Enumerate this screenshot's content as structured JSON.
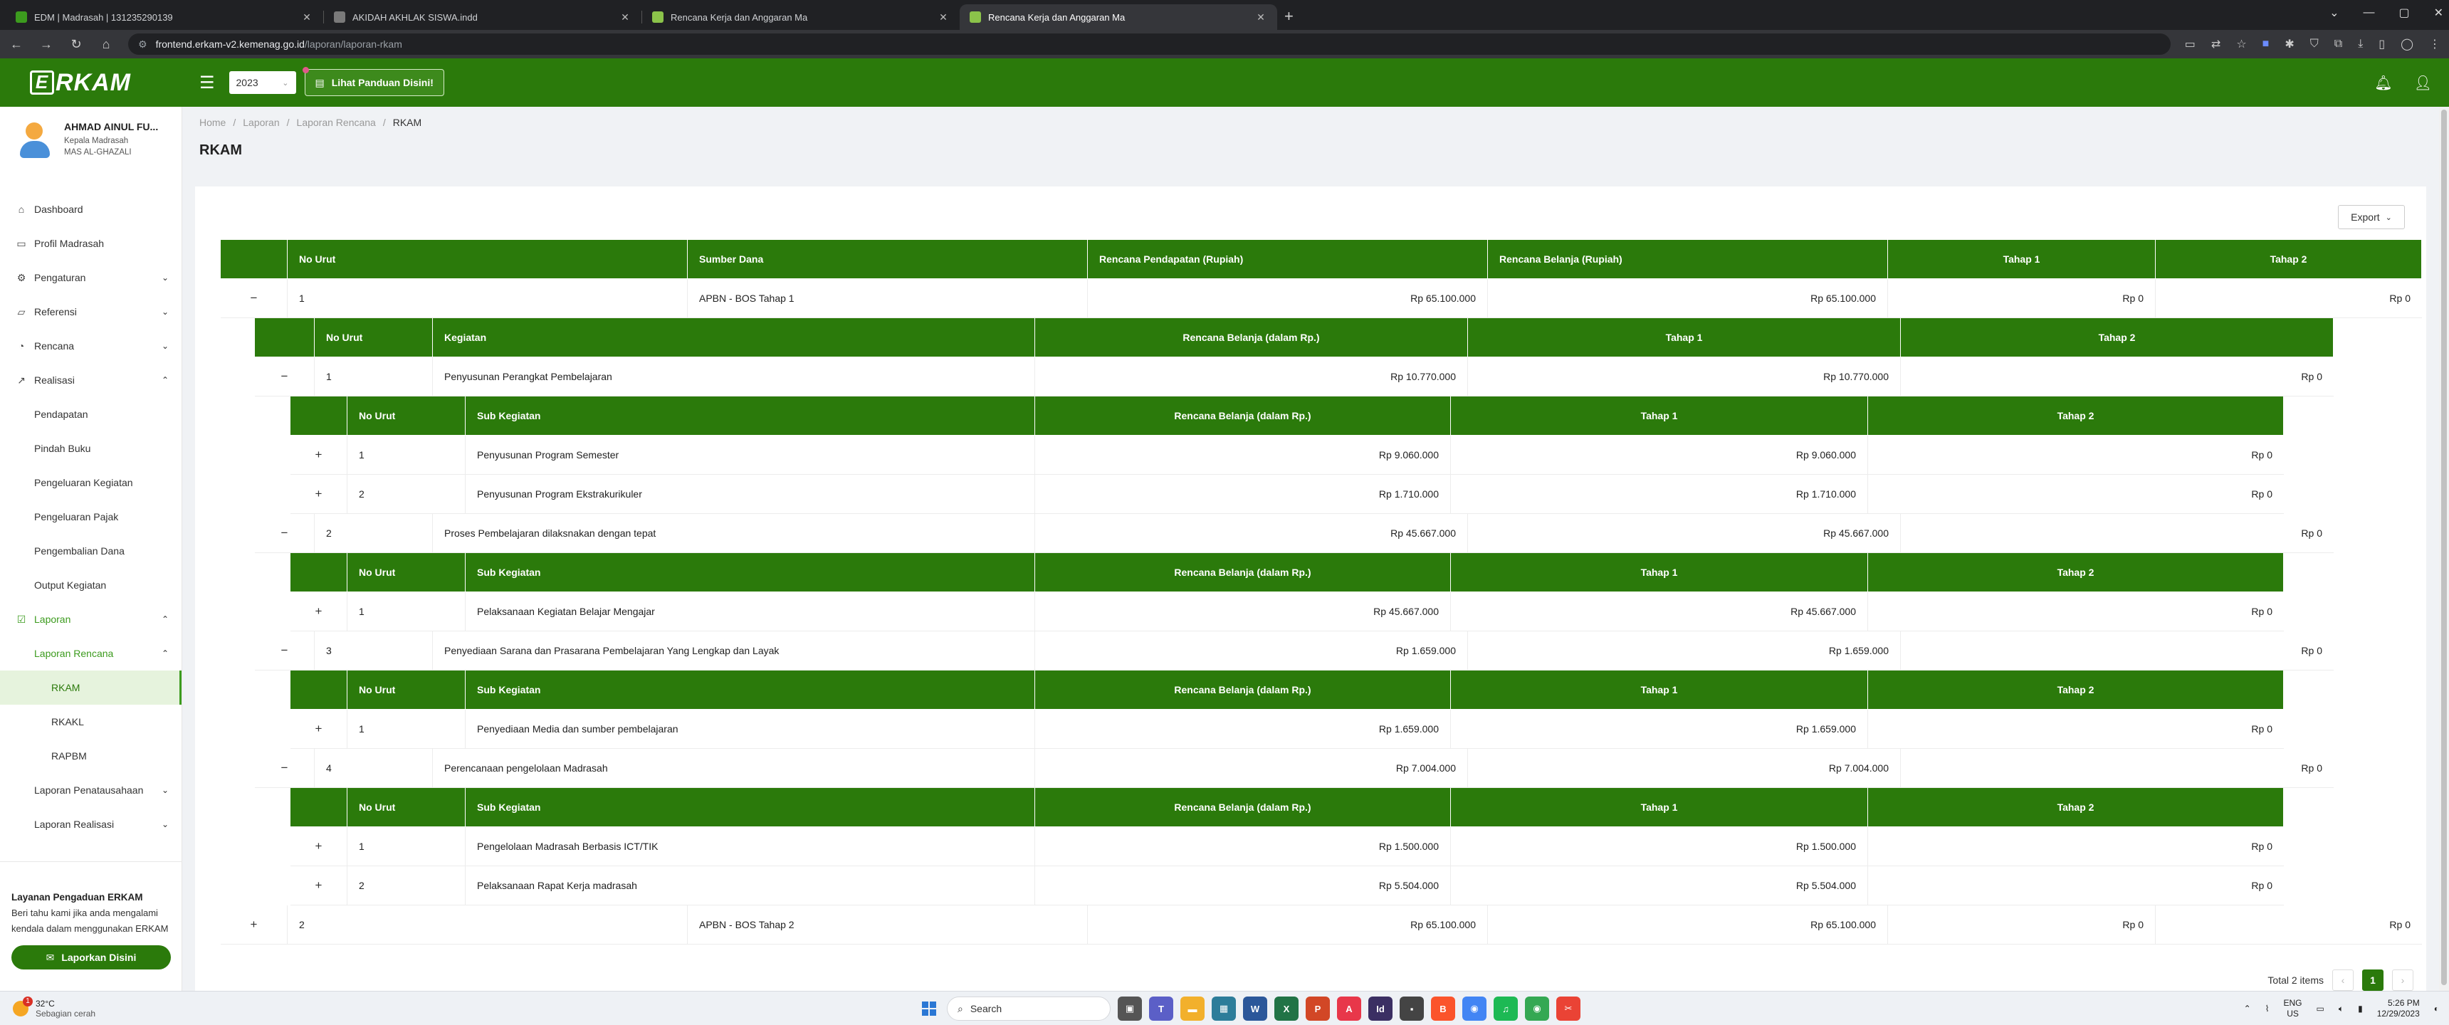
{
  "browser": {
    "tabs": [
      {
        "title": "EDM | Madrasah | 131235290139",
        "fav_color": "#3c9b1e",
        "active": false
      },
      {
        "title": "AKIDAH AKHLAK SISWA.indd",
        "fav_color": "#7a7a7a",
        "active": false
      },
      {
        "title": "Rencana Kerja dan Anggaran Ma",
        "fav_color": "#8bc34a",
        "active": false
      },
      {
        "title": "Rencana Kerja dan Anggaran Ma",
        "fav_color": "#8bc34a",
        "active": true
      }
    ],
    "url_host": "frontend.erkam-v2.kemenag.go.id",
    "url_path": "/laporan/laporan-rkam"
  },
  "header": {
    "logo": "ERKAM",
    "year": "2023",
    "guide_label": "Lihat Panduan Disini!"
  },
  "profile": {
    "name": "AHMAD AINUL FU...",
    "role": "Kepala Madrasah",
    "school": "MAS AL-GHAZALI"
  },
  "sidebar": {
    "dashboard": "Dashboard",
    "profil": "Profil Madrasah",
    "pengaturan": "Pengaturan",
    "referensi": "Referensi",
    "rencana": "Rencana",
    "realisasi": "Realisasi",
    "realisasi_items": [
      "Pendapatan",
      "Pindah Buku",
      "Pengeluaran Kegiatan",
      "Pengeluaran Pajak",
      "Pengembalian Dana",
      "Output Kegiatan"
    ],
    "laporan": "Laporan",
    "laporan_rencana": "Laporan Rencana",
    "laporan_rencana_items": [
      "RKAM",
      "RKAKL",
      "RAPBM"
    ],
    "laporan_penatausahaan": "Laporan Penatausahaan",
    "laporan_realisasi": "Laporan Realisasi"
  },
  "complaint": {
    "title": "Layanan Pengaduan ERKAM",
    "desc": "Beri tahu kami jika anda mengalami kendala dalam menggunakan ERKAM",
    "button": "Laporkan Disini"
  },
  "breadcrumb": [
    "Home",
    "Laporan",
    "Laporan Rencana",
    "RKAM"
  ],
  "page_title": "RKAM",
  "export_label": "Export",
  "table": {
    "headers": [
      "No Urut",
      "Sumber Dana",
      "Rencana Pendapatan (Rupiah)",
      "Rencana Belanja (Rupiah)",
      "Tahap 1",
      "Tahap 2"
    ],
    "sub_headers": [
      "No Urut",
      "Kegiatan",
      "Rencana Belanja (dalam Rp.)",
      "Tahap 1",
      "Tahap 2"
    ],
    "subsub_headers": [
      "No Urut",
      "Sub Kegiatan",
      "Rencana Belanja (dalam Rp.)",
      "Tahap 1",
      "Tahap 2"
    ],
    "rows": [
      {
        "expander": "−",
        "no": "1",
        "sumber": "APBN - BOS Tahap 1",
        "pendapatan": "Rp 65.100.000",
        "belanja": "Rp 65.100.000",
        "tahap1": "Rp 0",
        "tahap2": "Rp 0",
        "kegiatan": [
          {
            "expander": "−",
            "no": "1",
            "name": "Penyusunan Perangkat Pembelajaran",
            "belanja": "Rp 10.770.000",
            "tahap1": "Rp 10.770.000",
            "tahap2": "Rp 0",
            "sub": [
              {
                "expander": "+",
                "no": "1",
                "name": "Penyusunan Program Semester",
                "belanja": "Rp 9.060.000",
                "tahap1": "Rp 9.060.000",
                "tahap2": "Rp 0"
              },
              {
                "expander": "+",
                "no": "2",
                "name": "Penyusunan Program Ekstrakurikuler",
                "belanja": "Rp 1.710.000",
                "tahap1": "Rp 1.710.000",
                "tahap2": "Rp 0"
              }
            ]
          },
          {
            "expander": "−",
            "no": "2",
            "name": "Proses Pembelajaran dilaksnakan dengan tepat",
            "belanja": "Rp 45.667.000",
            "tahap1": "Rp 45.667.000",
            "tahap2": "Rp 0",
            "sub": [
              {
                "expander": "+",
                "no": "1",
                "name": "Pelaksanaan Kegiatan Belajar Mengajar",
                "belanja": "Rp 45.667.000",
                "tahap1": "Rp 45.667.000",
                "tahap2": "Rp 0"
              }
            ]
          },
          {
            "expander": "−",
            "no": "3",
            "name": "Penyediaan Sarana dan Prasarana Pembelajaran Yang Lengkap dan Layak",
            "belanja": "Rp 1.659.000",
            "tahap1": "Rp 1.659.000",
            "tahap2": "Rp 0",
            "sub": [
              {
                "expander": "+",
                "no": "1",
                "name": "Penyediaan Media dan sumber pembelajaran",
                "belanja": "Rp 1.659.000",
                "tahap1": "Rp 1.659.000",
                "tahap2": "Rp 0"
              }
            ]
          },
          {
            "expander": "−",
            "no": "4",
            "name": "Perencanaan pengelolaan Madrasah",
            "belanja": "Rp 7.004.000",
            "tahap1": "Rp 7.004.000",
            "tahap2": "Rp 0",
            "sub": [
              {
                "expander": "+",
                "no": "1",
                "name": "Pengelolaan Madrasah Berbasis ICT/TIK",
                "belanja": "Rp 1.500.000",
                "tahap1": "Rp 1.500.000",
                "tahap2": "Rp 0"
              },
              {
                "expander": "+",
                "no": "2",
                "name": "Pelaksanaan Rapat Kerja madrasah",
                "belanja": "Rp 5.504.000",
                "tahap1": "Rp 5.504.000",
                "tahap2": "Rp 0"
              }
            ]
          }
        ]
      },
      {
        "expander": "+",
        "no": "2",
        "sumber": "APBN - BOS Tahap 2",
        "pendapatan": "Rp 65.100.000",
        "belanja": "Rp 65.100.000",
        "tahap1": "Rp 0",
        "tahap2": "Rp 0",
        "kegiatan": []
      }
    ]
  },
  "pagination": {
    "total_label": "Total 2 items",
    "current": "1"
  },
  "taskbar": {
    "temp": "32°C",
    "weather": "Sebagian cerah",
    "search_placeholder": "Search",
    "lang": "ENG",
    "region": "US",
    "time": "5:26 PM",
    "date": "12/29/2023",
    "weather_badge": "1"
  },
  "colors": {
    "brand": "#2b7a0b",
    "accent": "#3c9b1e"
  }
}
